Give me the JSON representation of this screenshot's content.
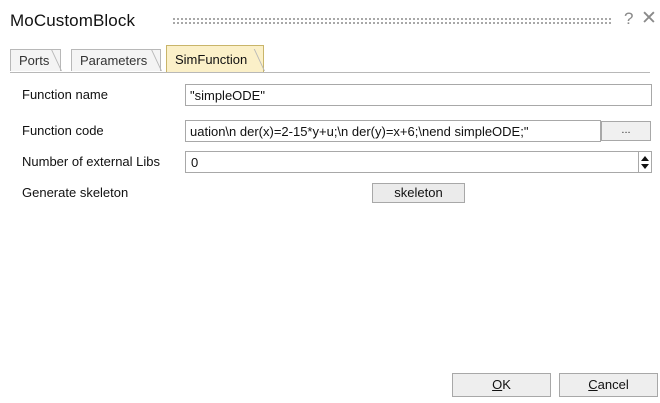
{
  "window": {
    "title": "MoCustomBlock",
    "help_glyph": "?",
    "close_glyph": "✕"
  },
  "tabs": [
    {
      "label": "Ports",
      "active": false
    },
    {
      "label": "Parameters",
      "active": false
    },
    {
      "label": "SimFunction",
      "active": true
    }
  ],
  "form": {
    "function_name": {
      "label": "Function name",
      "value": "\"simpleODE\""
    },
    "function_code": {
      "label": "Function code",
      "value": "uation\\n   der(x)=2-15*y+u;\\n   der(y)=x+6;\\nend simpleODE;\"",
      "browse_label": "..."
    },
    "external_libs": {
      "label": "Number of external Libs",
      "value": "0"
    },
    "skeleton": {
      "label": "Generate skeleton",
      "button_label": "skeleton"
    }
  },
  "footer": {
    "ok_accel": "O",
    "ok_rest": "K",
    "cancel_accel": "C",
    "cancel_rest": "ancel"
  },
  "colors": {
    "active_tab": "#fbf0c8",
    "border": "#a8a8a8"
  }
}
